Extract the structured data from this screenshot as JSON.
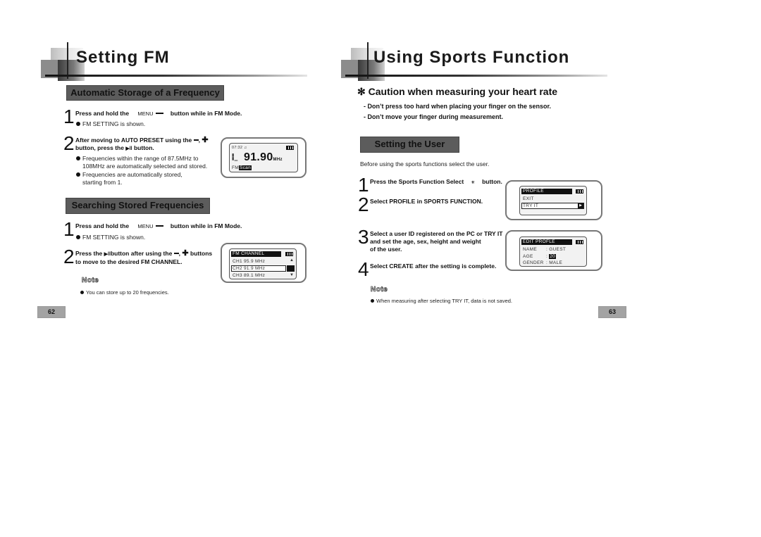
{
  "left_page": {
    "title": "Setting FM",
    "section1": {
      "heading": "Automatic Storage of a Frequency",
      "step1": {
        "number": "1",
        "text_before": "Press and hold the",
        "key_label": "MENU",
        "text_after": "button while in FM Mode.",
        "bullet": "FM SETTING is shown."
      },
      "step2": {
        "number": "2",
        "line1": "After moving to AUTO PRESET using the",
        "line2_before": "button, press the",
        "line2_after": "button.",
        "bullets": [
          "Frequencies within the range of 87.5MHz to",
          "108MHz are automatically selected and stored.",
          "Frequencies are automatically stored,",
          "starting from 1."
        ]
      },
      "lcd": {
        "time": "07:32",
        "frequency": "91.90",
        "unit": "MHz",
        "mode_label": "FM",
        "scan_label": "Scan"
      }
    },
    "section2": {
      "heading": "Searching Stored Frequencies",
      "step1": {
        "number": "1",
        "text_before": "Press and hold the",
        "key_label": "MENU",
        "text_after": "button while in FM Mode.",
        "bullet": "FM SETTING is shown."
      },
      "step2": {
        "number": "2",
        "line1_before": "Press the",
        "line1_mid": "button after using the",
        "line1_after": "buttons",
        "line2": "to move to the desired FM CHANNEL."
      },
      "lcd": {
        "header": "FM CHANNEL",
        "channels": [
          {
            "label": "CH1  95.9 MHz"
          },
          {
            "label": "CH2  91.9 MHz"
          },
          {
            "label": "CH3  89.1 MHz"
          }
        ],
        "selected_index": 1
      }
    },
    "note": {
      "title": "Note",
      "text": "You can store up to 20 frequencies."
    },
    "page_number": "62"
  },
  "right_page": {
    "title": "Using Sports Function",
    "caution": {
      "symbol": "✻",
      "title": "Caution when measuring your heart rate",
      "lines": [
        "- Don’t press too hard when placing your finger on the sensor.",
        "- Don’t move your finger during measurement."
      ]
    },
    "section": {
      "heading": "Setting the User",
      "intro": "Before using the sports functions select the user.",
      "steps": [
        {
          "number": "1",
          "text_before": "Press the Sports Function Select",
          "text_after": "button."
        },
        {
          "number": "2",
          "text": "Select PROFILE in SPORTS FUNCTION."
        },
        {
          "number": "3",
          "lines": [
            "Select a user ID registered on the PC or TRY IT",
            "and set the age, sex, height and weight",
            "of the user."
          ]
        },
        {
          "number": "4",
          "text": "Select CREATE after the setting is complete."
        }
      ],
      "lcd_profile": {
        "header": "PROFILE",
        "items": [
          "EXIT",
          "TRY IT"
        ],
        "selected_index": 1
      },
      "lcd_edit": {
        "header": "EDIT PROFLE",
        "fields": [
          {
            "label": "NAME",
            "value": ": GUEST"
          },
          {
            "label": "AGE",
            "value": "20"
          },
          {
            "label": "GENDER",
            "value": ": MALE"
          }
        ]
      }
    },
    "note": {
      "title": "Note",
      "text": "When measuring after selecting TRY IT, data is not saved."
    },
    "page_number": "63"
  }
}
